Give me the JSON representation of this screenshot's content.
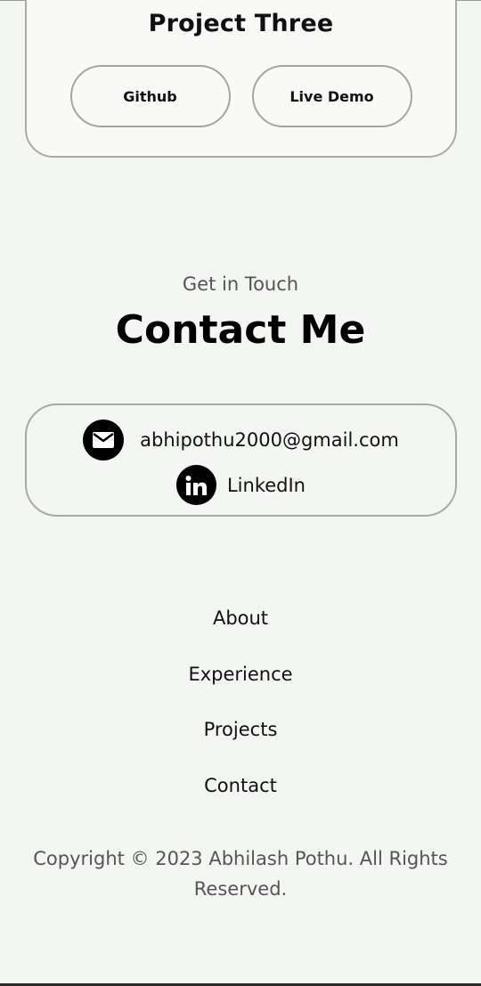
{
  "project": {
    "title": "Project Three",
    "github_label": "Github",
    "demo_label": "Live Demo"
  },
  "contact": {
    "subtitle": "Get in Touch",
    "title": "Contact Me",
    "email": "abhipothu2000@gmail.com",
    "linkedin": "LinkedIn",
    "email_icon": "mail-icon",
    "linkedin_icon": "linkedin-icon"
  },
  "nav": {
    "items": [
      "About",
      "Experience",
      "Projects",
      "Contact"
    ]
  },
  "footer": {
    "copyright": "Copyright © 2023 Abhilash Pothu. All Rights Reserved."
  },
  "colors": {
    "background": "#f3f6f2",
    "border": "#a9aaa8",
    "text": "#111111",
    "muted": "#555555"
  }
}
